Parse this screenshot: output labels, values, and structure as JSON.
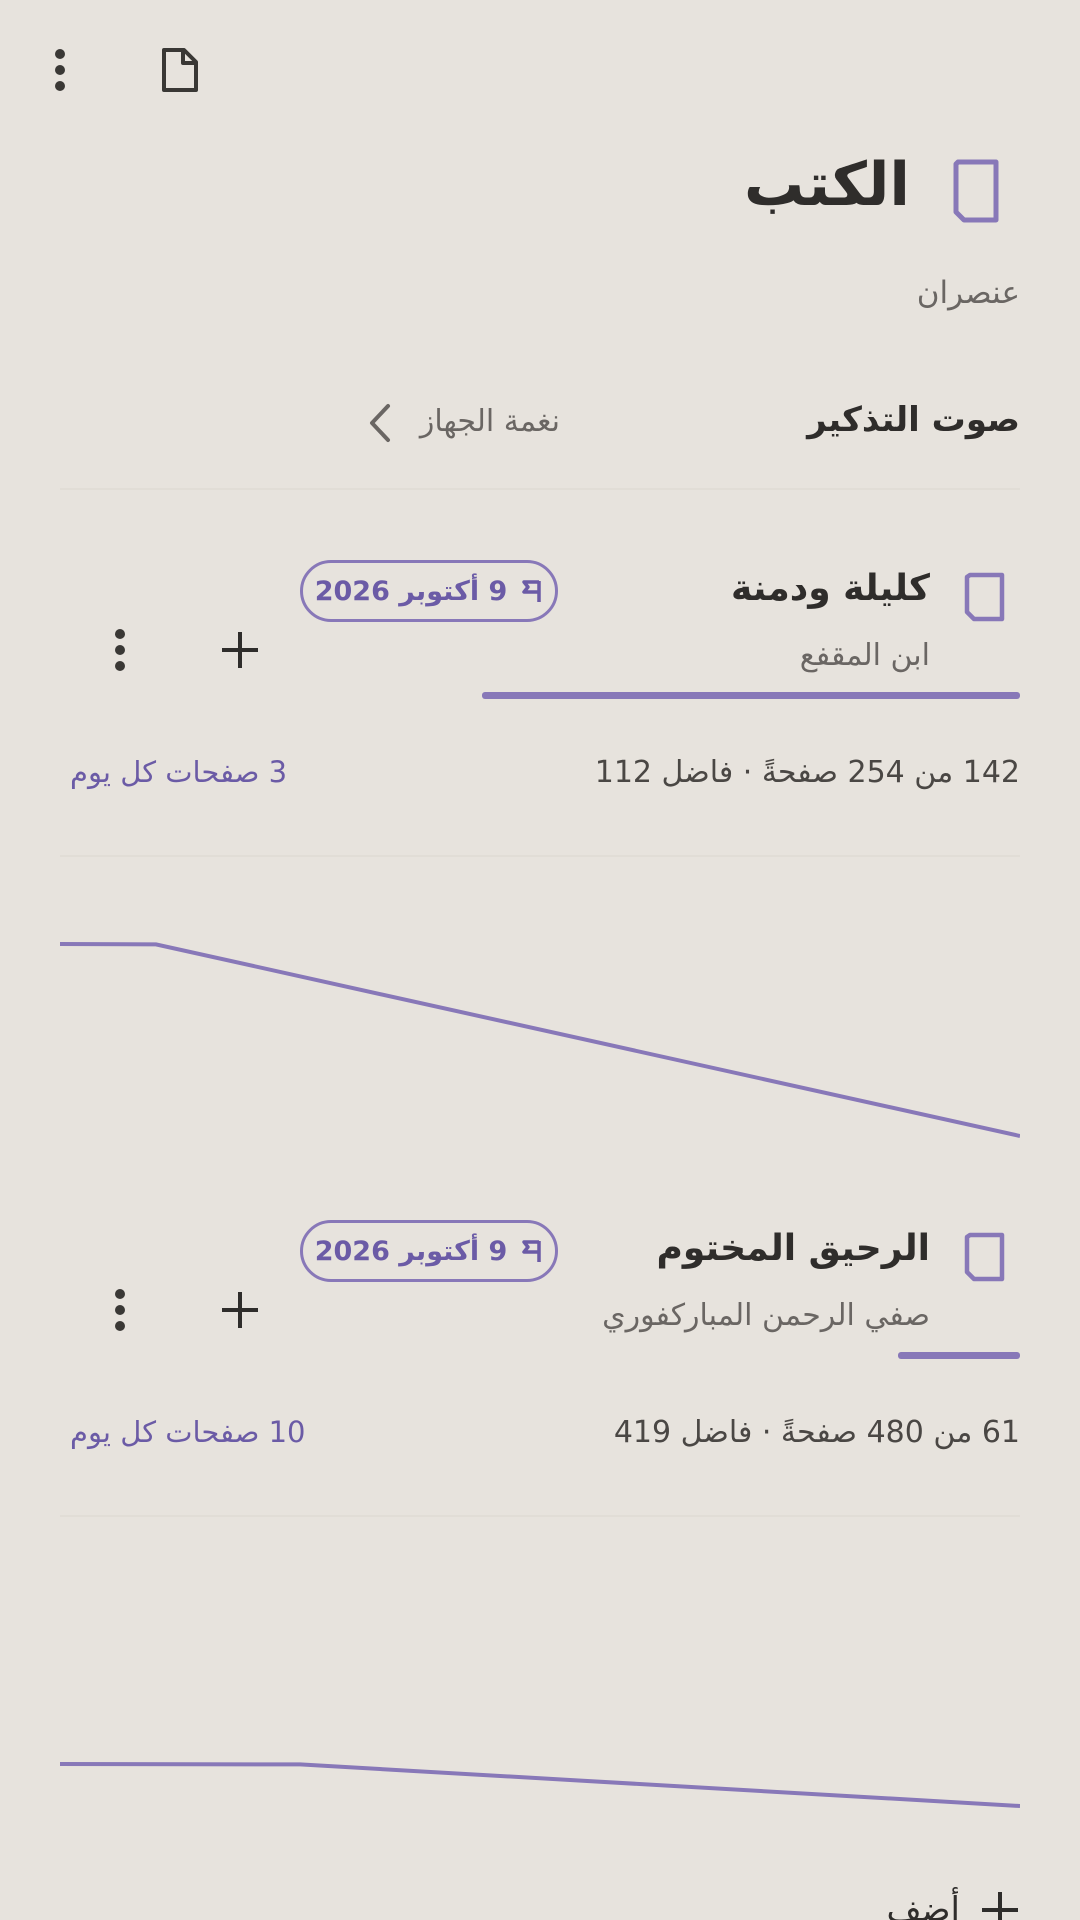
{
  "topbar": {
    "menu_icon": "more-vert-icon",
    "doc_icon": "document-icon"
  },
  "header": {
    "title": "الكتب",
    "subtitle": "عنصران",
    "icon": "book-icon"
  },
  "settings": {
    "reminder_sound_label": "صوت التذكير",
    "reminder_sound_value": "نغمة الجهاز"
  },
  "books": [
    {
      "title": "كليلة ودمنة",
      "author": "ابن المقفع",
      "deadline": "9 أكتوبر 2026",
      "stats": "142 من 254 صفحةً · فاضل 112",
      "daily": "3 صفحات كل يوم",
      "progress": 0.56,
      "chart_data": {
        "type": "line",
        "series": [
          {
            "values": [
              1.0,
              0.998,
              0.0
            ]
          }
        ],
        "x": [
          0,
          0.1,
          1.0
        ]
      }
    },
    {
      "title": "الرحيق المختوم",
      "author": "صفي الرحمن المباركفوري",
      "deadline": "9 أكتوبر 2026",
      "stats": "61 من 480 صفحةً · فاضل 419",
      "daily": "10 صفحات كل يوم",
      "progress": 0.127,
      "chart_data": {
        "type": "line",
        "series": [
          {
            "values": [
              1.0,
              0.99,
              0.0
            ]
          }
        ],
        "x": [
          0,
          0.25,
          1.0
        ]
      }
    }
  ],
  "add": {
    "label": "أضف"
  },
  "colors": {
    "accent": "#8878B8",
    "accent_text": "#6b5ba6",
    "background": "#E7E3DD"
  }
}
